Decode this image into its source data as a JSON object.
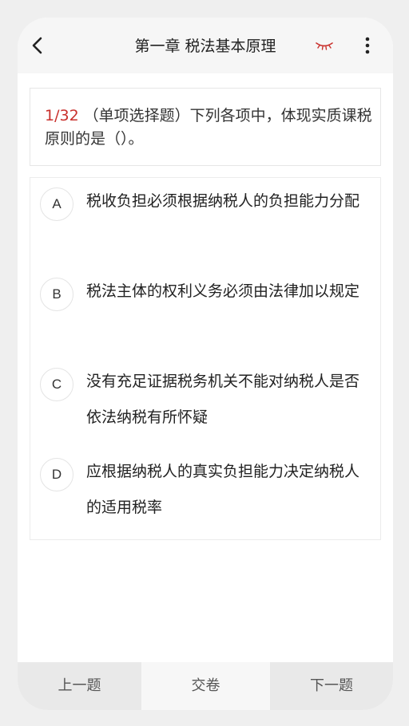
{
  "header": {
    "title": "第一章 税法基本原理",
    "back_icon": "chevron-left-icon",
    "eye_icon": "eye-closed-icon",
    "more_icon": "more-vertical-icon",
    "accent_color": "#c9302c"
  },
  "question": {
    "number": "1/32",
    "text": "（单项选择题）下列各项中，体现实质课税原则的是（）。"
  },
  "options": [
    {
      "letter": "A",
      "text": "税收负担必须根据纳税人的负担能力分配"
    },
    {
      "letter": "B",
      "text": "税法主体的权利义务必须由法律加以规定"
    },
    {
      "letter": "C",
      "text": "没有充足证据税务机关不能对纳税人是否依法纳税有所怀疑"
    },
    {
      "letter": "D",
      "text": "应根据纳税人的真实负担能力决定纳税人的适用税率"
    }
  ],
  "footer": {
    "prev_label": "上一题",
    "submit_label": "交卷",
    "next_label": "下一题"
  }
}
